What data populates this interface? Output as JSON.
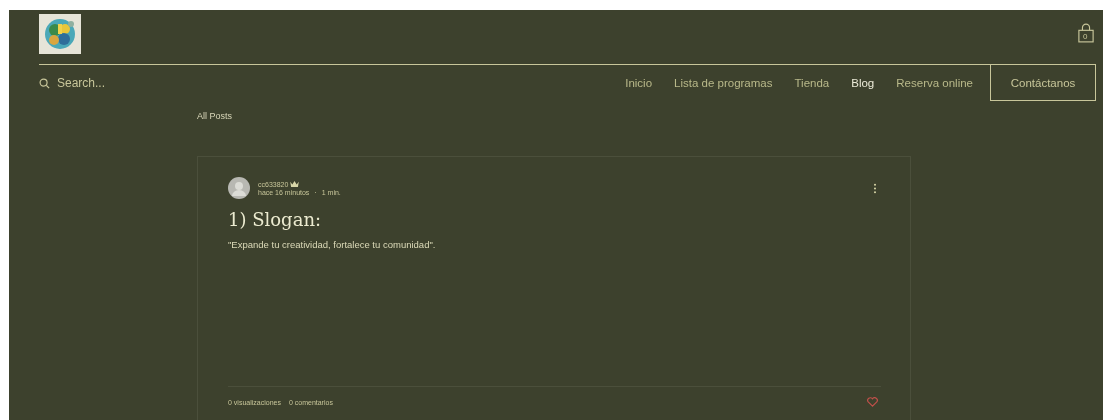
{
  "header": {
    "cart_count": "0"
  },
  "search": {
    "placeholder": "Search..."
  },
  "nav": [
    {
      "label": "Inicio",
      "selected": false
    },
    {
      "label": "Lista de programas",
      "selected": false
    },
    {
      "label": "Tienda",
      "selected": false
    },
    {
      "label": "Blog",
      "selected": true
    },
    {
      "label": "Reserva online",
      "selected": false
    }
  ],
  "contact_button": "Contáctanos",
  "breadcrumb": "All Posts",
  "post": {
    "author": "cc633820",
    "time": "hace 16 minutos",
    "separator": "·",
    "read_time": "1 min.",
    "title": "1) Slogan:",
    "excerpt": "\"Expande tu creatividad, fortalece tu comunidad\".",
    "views": "0 visualizaciones",
    "comments": "0 comentarios",
    "liked": false
  }
}
